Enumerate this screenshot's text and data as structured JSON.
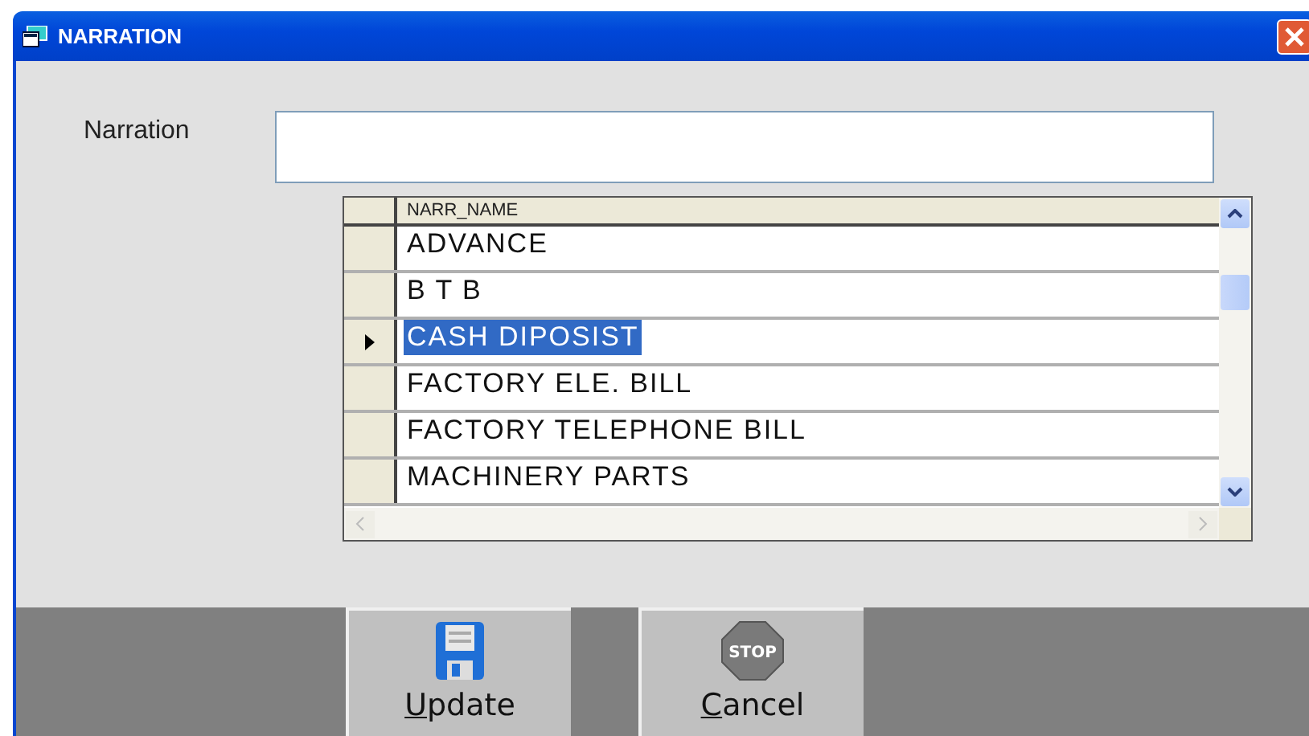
{
  "window": {
    "title": "NARRATION"
  },
  "narration_field": {
    "label": "Narration"
  },
  "grid": {
    "columns": [
      "NARR_NAME"
    ],
    "rows": [
      {
        "name": "ADVANCE",
        "selected": false
      },
      {
        "name": "B T B",
        "selected": false
      },
      {
        "name": "CASH DIPOSIST",
        "selected": true
      },
      {
        "name": "FACTORY ELE. BILL",
        "selected": false
      },
      {
        "name": "FACTORY TELEPHONE BILL",
        "selected": false
      },
      {
        "name": "MACHINERY PARTS",
        "selected": false
      }
    ]
  },
  "buttons": [
    {
      "label": "Update",
      "kind": "save"
    },
    {
      "label": "Cancel",
      "kind": "stop",
      "icon_text": "STOP"
    }
  ]
}
